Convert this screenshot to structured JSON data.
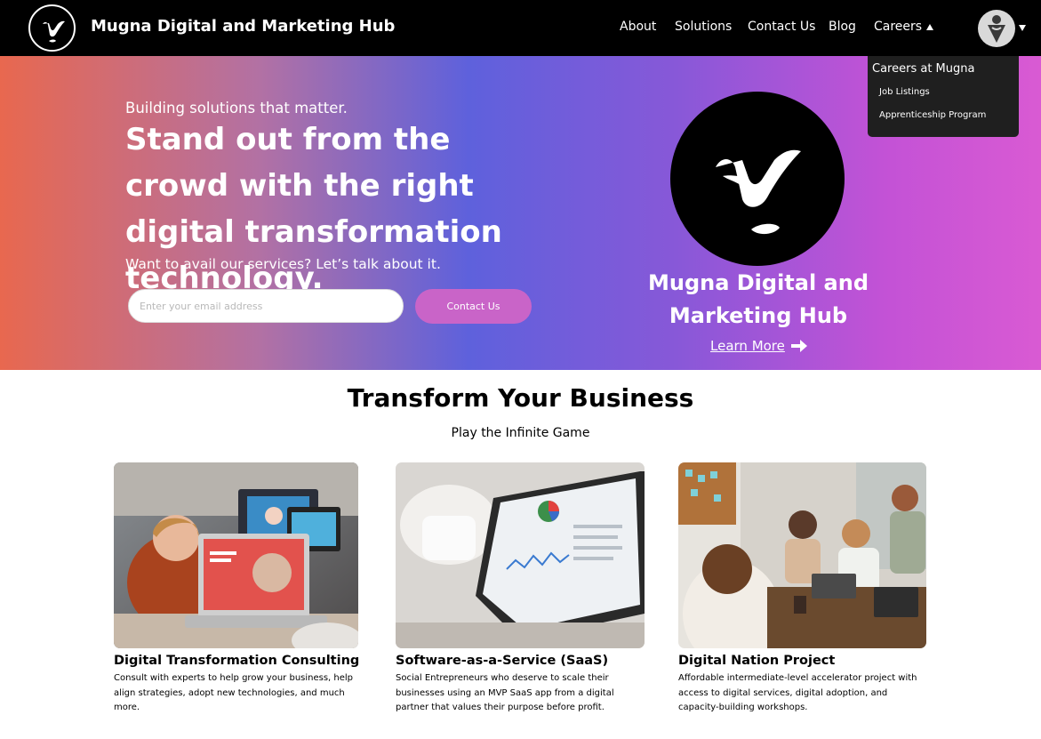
{
  "navbar": {
    "brand": "Mugna Digital and Marketing Hub",
    "links": {
      "about": "About",
      "solutions": "Solutions",
      "contact": "Contact Us",
      "blog": "Blog",
      "careers": "Careers"
    }
  },
  "dropdown": {
    "title": "Careers at Mugna",
    "items": [
      "Job Listings",
      "Apprenticeship Program"
    ]
  },
  "hero": {
    "tagline": "Building solutions that matter.",
    "headline": "Stand out from the crowd with the right digital transformation technology.",
    "subtext": "Want to avail our services? Let’s talk about it.",
    "email_placeholder": "Enter your email address",
    "email_value": "",
    "contact_button": "Contact Us",
    "brand": "Mugna Digital and Marketing Hub",
    "learn_more": "Learn More"
  },
  "section": {
    "title": "Transform Your Business",
    "subtitle": "Play the Infinite Game"
  },
  "cards": [
    {
      "title": "Digital Transformation Consulting",
      "description": "Consult with experts to help grow your business, help align strategies, adopt new technologies, and much more."
    },
    {
      "title": "Software-as-a-Service (SaaS)",
      "description": "Social Entrepreneurs who deserve to scale their businesses using an MVP SaaS app from a digital partner that values their purpose before profit."
    },
    {
      "title": "Digital Nation Project",
      "description": "Affordable intermediate-level accelerator project with access to digital services, digital adoption, and capacity-building workshops."
    }
  ],
  "colors": {
    "navbar_bg": "#000000",
    "accent_pink": "#c964c8",
    "dropdown_bg": "#1f1f1f",
    "hero_gradient_start": "#e8684f",
    "hero_gradient_mid": "#5e61dc",
    "hero_gradient_end": "#d95ad3"
  },
  "icons": {
    "brand_logo": "mugna-logo-icon",
    "avatar": "user-avatar-icon",
    "careers_caret": "caret-up-icon",
    "avatar_caret": "caret-down-icon",
    "learn_more_arrow": "arrow-right-icon"
  }
}
